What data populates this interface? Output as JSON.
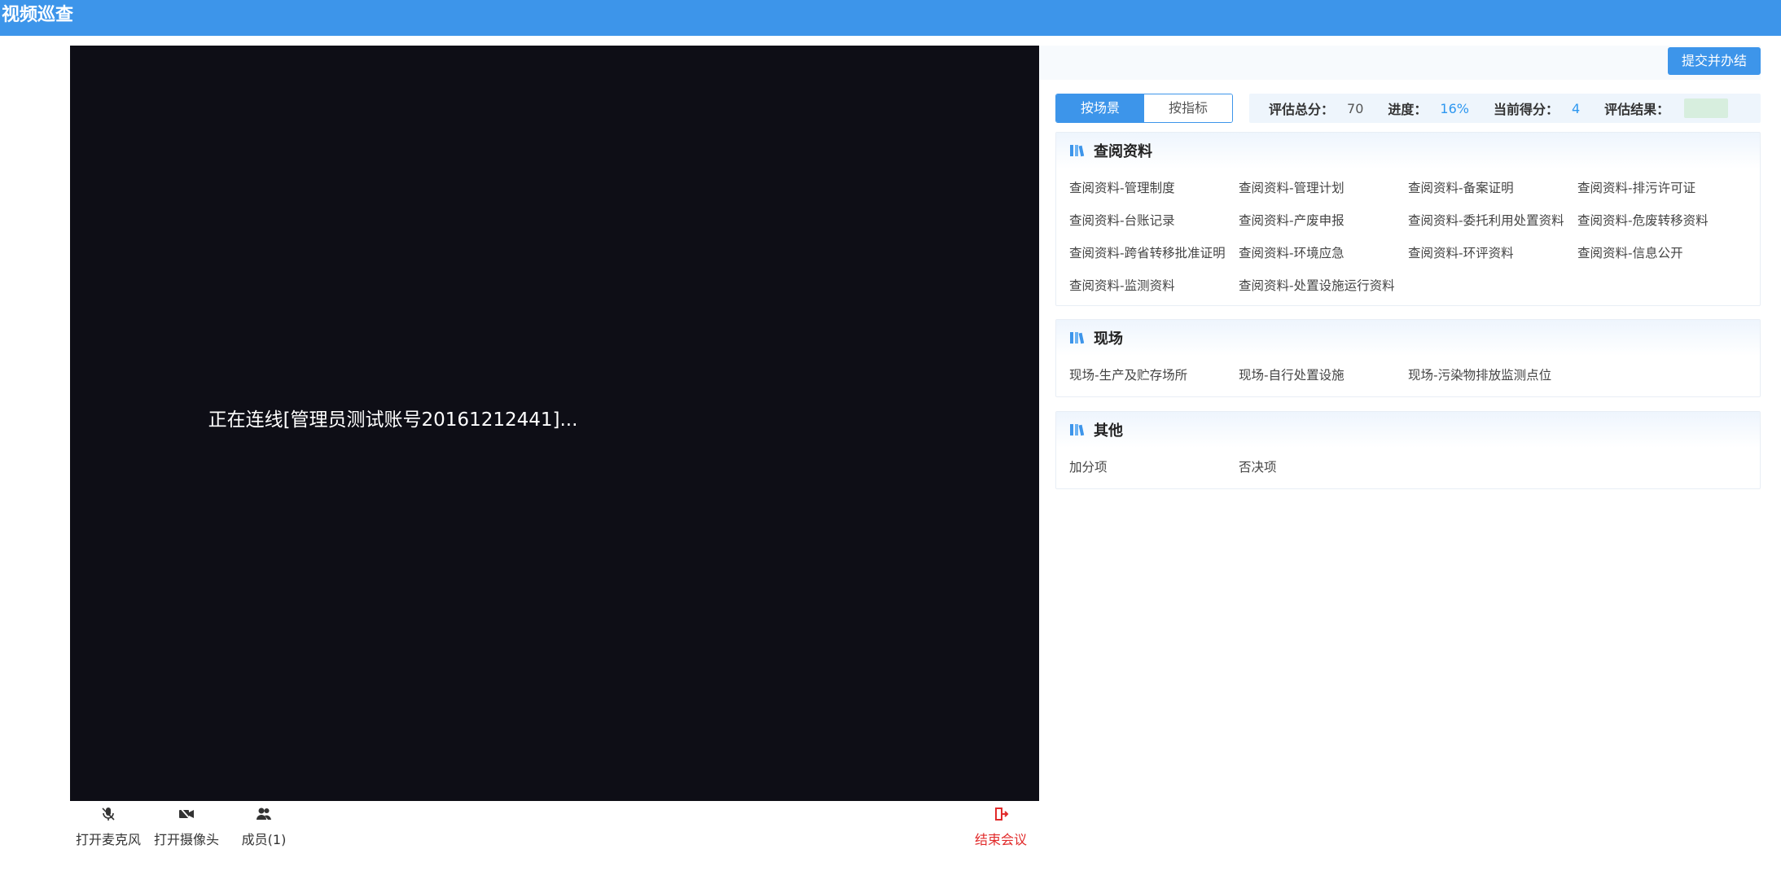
{
  "app": {
    "title": "视频巡查"
  },
  "video": {
    "status_text": "正在连线[管理员测试账号20161212441]..."
  },
  "controls": {
    "mic": {
      "label": "打开麦克风",
      "icon": "microphone-off-icon"
    },
    "camera": {
      "label": "打开摄像头",
      "icon": "camera-off-icon"
    },
    "members": {
      "label": "成员(1)",
      "icon": "members-icon"
    },
    "end": {
      "label": "结束会议",
      "icon": "exit-door-icon",
      "color": "#e12a2a"
    }
  },
  "toolbar": {
    "submit_label": "提交并办结"
  },
  "tabs": [
    {
      "label": "按场景",
      "active": true
    },
    {
      "label": "按指标",
      "active": false
    }
  ],
  "stats": {
    "total_label": "评估总分：",
    "total_value": "70",
    "progress_label": "进度：",
    "progress_value": "16%",
    "score_label": "当前得分：",
    "score_value": "4",
    "result_label": "评估结果："
  },
  "sections": [
    {
      "title": "查阅资料",
      "icon": "books-icon",
      "items": [
        "查阅资料-管理制度",
        "查阅资料-管理计划",
        "查阅资料-备案证明",
        "查阅资料-排污许可证",
        "查阅资料-台账记录",
        "查阅资料-产废申报",
        "查阅资料-委托利用处置资料",
        "查阅资料-危废转移资料",
        "查阅资料-跨省转移批准证明",
        "查阅资料-环境应急",
        "查阅资料-环评资料",
        "查阅资料-信息公开",
        "查阅资料-监测资料",
        "查阅资料-处置设施运行资料"
      ]
    },
    {
      "title": "现场",
      "icon": "books-icon",
      "items": [
        "现场-生产及贮存场所",
        "现场-自行处置设施",
        "现场-污染物排放监测点位"
      ]
    },
    {
      "title": "其他",
      "icon": "books-icon",
      "items": [
        "加分项",
        "否决项"
      ]
    }
  ],
  "colors": {
    "accent": "#3d95ea",
    "video_bg": "#0e0e16",
    "danger": "#e12a2a",
    "progress_blue": "#2d97f0"
  }
}
